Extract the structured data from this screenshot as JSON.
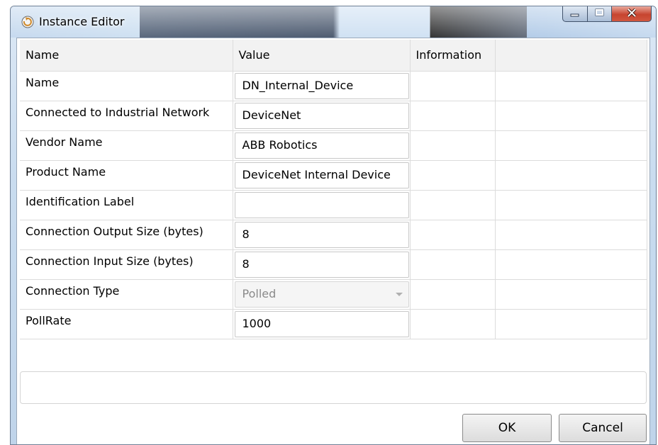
{
  "window": {
    "title": "Instance Editor",
    "icon": "refresh-icon",
    "controls": [
      "minimize-icon",
      "maximize-icon",
      "close-icon"
    ]
  },
  "grid": {
    "headers": [
      "Name",
      "Value",
      "Information"
    ],
    "rows": [
      {
        "name": "Name",
        "value": "DN_Internal_Device",
        "type": "text"
      },
      {
        "name": "Connected to Industrial Network",
        "value": "DeviceNet",
        "type": "text"
      },
      {
        "name": "Vendor Name",
        "value": "ABB Robotics",
        "type": "text"
      },
      {
        "name": "Product Name",
        "value": "DeviceNet Internal Device",
        "type": "text"
      },
      {
        "name": "Identification Label",
        "value": "",
        "type": "text"
      },
      {
        "name": "Connection Output Size (bytes)",
        "value": "8",
        "type": "text"
      },
      {
        "name": "Connection Input Size (bytes)",
        "value": "8",
        "type": "text"
      },
      {
        "name": "Connection Type",
        "value": "Polled",
        "type": "select-disabled"
      },
      {
        "name": "PollRate",
        "value": "1000",
        "type": "text"
      }
    ]
  },
  "message": "",
  "buttons": {
    "ok": "OK",
    "cancel": "Cancel"
  }
}
